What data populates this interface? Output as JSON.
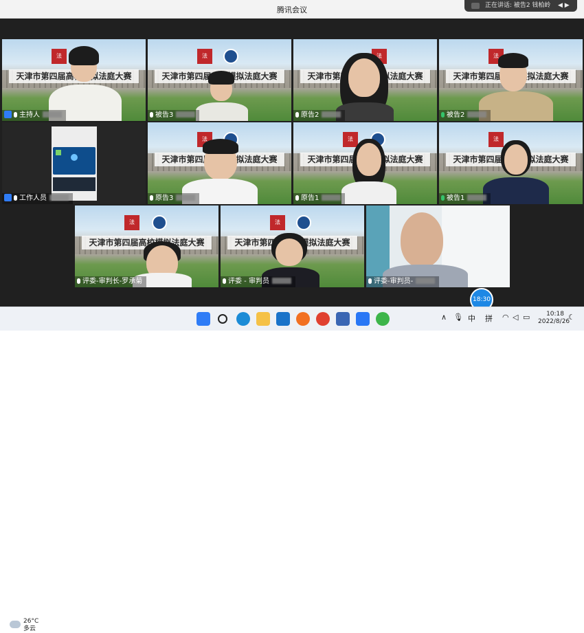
{
  "window": {
    "title": "腾讯会议"
  },
  "speaking": {
    "text": "正在讲话: 被告2 钱柏岭"
  },
  "banner_text": "天津市第四届高校模拟法庭大赛",
  "participants": [
    {
      "name": "主持人",
      "role": "host"
    },
    {
      "name": "被告3"
    },
    {
      "name": "原告2"
    },
    {
      "name": "被告2",
      "mic": "green"
    },
    {
      "name": "工作人员",
      "role": "host"
    },
    {
      "name": "原告3"
    },
    {
      "name": "原告1"
    },
    {
      "name": "被告1",
      "mic": "green"
    },
    {
      "name": "评委-审判长-罗承菊"
    },
    {
      "name": "评委 - 审判员"
    },
    {
      "name": "评委-审判员-"
    }
  ],
  "timer": "18:30",
  "taskbar": {
    "weather_temp": "26°C",
    "weather_desc": "多云",
    "time": "10:18",
    "date": "2022/8/26",
    "ime1": "中",
    "ime2": "拼"
  },
  "colors": {
    "accent": "#1e88e5",
    "green_mic": "#35c36b",
    "host_badge": "#2f7cf6"
  }
}
